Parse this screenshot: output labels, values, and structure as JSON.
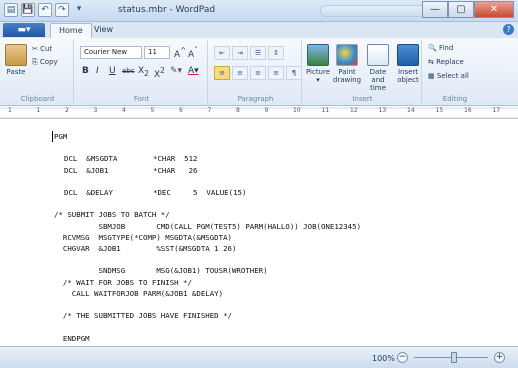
{
  "window": {
    "title": "status.mbr - WordPad",
    "buttons": {
      "minimize": "—",
      "maximize": "▢",
      "close": "✕"
    }
  },
  "quick_access": {
    "save": "💾",
    "undo": "↶",
    "redo": "↷",
    "more": "▾"
  },
  "ribbon": {
    "file_button": "▬▾",
    "tabs": [
      "Home",
      "View"
    ],
    "help": "?",
    "clipboard": {
      "paste": "Paste",
      "cut": "Cut",
      "copy": "Copy",
      "label": "Clipboard"
    },
    "font": {
      "family": "Courier New",
      "size": "11",
      "label": "Font"
    },
    "paragraph": {
      "label": "Paragraph"
    },
    "insert": {
      "picture": "Picture",
      "paint": "Paint",
      "paint2": "drawing",
      "date": "Date and",
      "date2": "time",
      "object": "Insert",
      "object2": "object",
      "label": "Insert"
    },
    "editing": {
      "find": "Find",
      "replace": "Replace",
      "select_all": "Select all",
      "label": "Editing"
    }
  },
  "ruler": {
    "numbers": [
      "1",
      "1",
      "2",
      "3",
      "4",
      "5",
      "6",
      "7",
      "8",
      "9",
      "10",
      "11",
      "12",
      "13",
      "14",
      "15",
      "16",
      "17"
    ]
  },
  "document": {
    "lines": [
      "PGM",
      "",
      "DCL  &MSGDTA        *CHAR  512",
      "DCL  &JOB1          *CHAR   26",
      "",
      "DCL  &DELAY         *DEC     5  VALUE(15)",
      "",
      "/* SUBMIT JOBS TO BATCH */",
      "          SBMJOB       CMD(CALL PGM(TEST5) PARM(HALLO)) JOB(ONE12345)",
      "  RCVMSG  MSGTYPE(*COMP) MSGDTA(&MSGDTA)",
      "  CHGVAR  &JOB1        %SST(&MSGDTA 1 26)",
      "",
      "          SNDMSG       MSG(&JOB1) TOUSR(WROTHER)",
      "  /* WAIT FOR JOBS TO FINISH */",
      "    CALL WAITFORJOB PARM(&JOB1 &DELAY)",
      "",
      "  /* THE SUBMITTED JOBS HAVE FINISHED */",
      "",
      "  ENDPGM"
    ]
  },
  "status": {
    "zoom": "100%",
    "zoom_level": 100,
    "zoom_out": "−",
    "zoom_in": "+"
  }
}
